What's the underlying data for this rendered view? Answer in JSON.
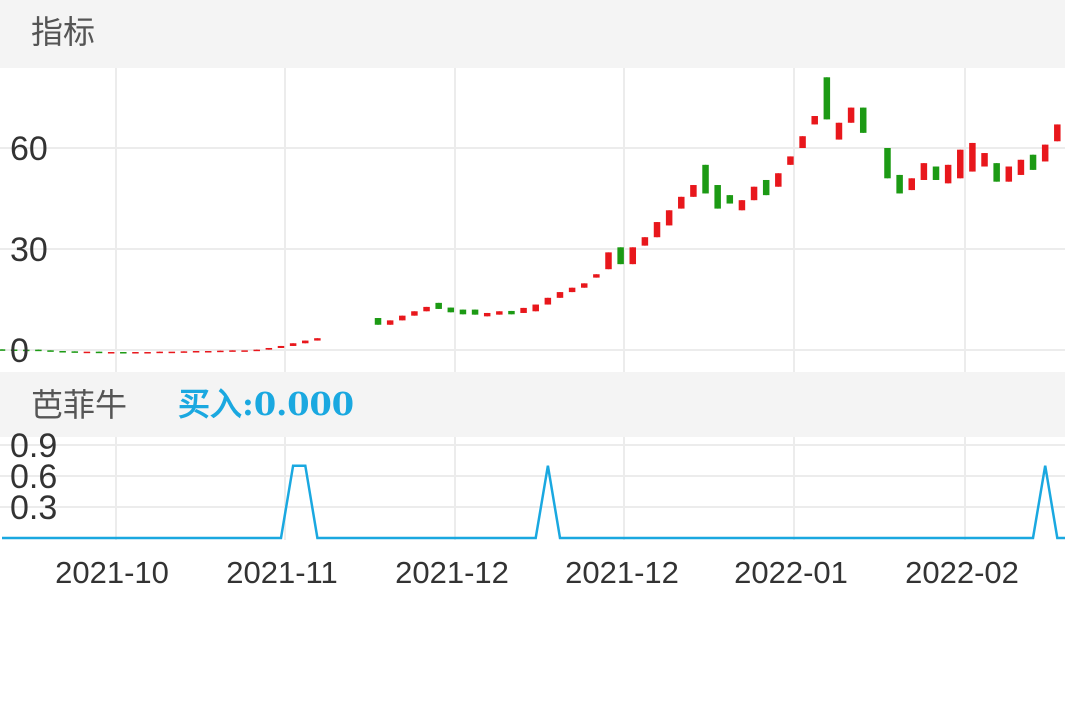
{
  "header": {
    "title": "指标"
  },
  "indicator": {
    "name": "芭菲牛",
    "buy_label": "买入:0.000"
  },
  "colors": {
    "up": "#e8171c",
    "down": "#1c9a14",
    "signal": "#1aa8e0",
    "grid": "#ececec",
    "panel": "#f4f4f4",
    "text": "#333333"
  },
  "chart_data": [
    {
      "type": "candlestick",
      "title": "",
      "y_ticks": [
        "60",
        "30",
        "0"
      ],
      "x_ticks": [
        "2021-10",
        "2021-11",
        "2021-12",
        "2021-12",
        "2022-01",
        "2022-02"
      ],
      "ylim": [
        -10,
        80
      ],
      "grid": true,
      "candles": [
        {
          "o": 0.2,
          "c": 0,
          "h": 0.2,
          "l": 0
        },
        {
          "o": 0.15,
          "c": 0,
          "h": 0.15,
          "l": 0
        },
        {
          "o": 0.1,
          "c": 0,
          "h": 0.1,
          "l": 0
        },
        {
          "o": 0.1,
          "c": -0.1,
          "h": 0.1,
          "l": -0.1
        },
        {
          "o": -0.1,
          "c": -0.3,
          "h": -0.1,
          "l": -0.3
        },
        {
          "o": -0.3,
          "c": -0.4,
          "h": -0.3,
          "l": -0.4
        },
        {
          "o": -0.4,
          "c": -0.5,
          "h": -0.4,
          "l": -0.5
        },
        {
          "o": -0.5,
          "c": -0.5,
          "h": -0.5,
          "l": -0.5
        },
        {
          "o": -0.5,
          "c": -0.6,
          "h": -0.5,
          "l": -0.6
        },
        {
          "o": -0.6,
          "c": -0.6,
          "h": -0.6,
          "l": -0.6
        },
        {
          "o": -0.6,
          "c": -0.7,
          "h": -0.6,
          "l": -0.7
        },
        {
          "o": -0.7,
          "c": -0.6,
          "h": -0.6,
          "l": -0.7
        },
        {
          "o": -0.6,
          "c": -0.6,
          "h": -0.6,
          "l": -0.6
        },
        {
          "o": -0.6,
          "c": -0.5,
          "h": -0.5,
          "l": -0.6
        },
        {
          "o": -0.5,
          "c": -0.5,
          "h": -0.5,
          "l": -0.5
        },
        {
          "o": -0.5,
          "c": -0.4,
          "h": -0.4,
          "l": -0.5
        },
        {
          "o": -0.4,
          "c": -0.3,
          "h": -0.3,
          "l": -0.4
        },
        {
          "o": -0.3,
          "c": -0.3,
          "h": -0.3,
          "l": -0.3
        },
        {
          "o": -0.3,
          "c": -0.2,
          "h": -0.2,
          "l": -0.3
        },
        {
          "o": -0.2,
          "c": -0.1,
          "h": -0.1,
          "l": -0.2
        },
        {
          "o": -0.1,
          "c": -0.1,
          "h": -0.1,
          "l": -0.1
        },
        {
          "o": -0.1,
          "c": 0.1,
          "h": 0.1,
          "l": -0.1
        },
        {
          "o": 0.1,
          "c": 0.6,
          "h": 0.6,
          "l": 0.1
        },
        {
          "o": 0.6,
          "c": 1.2,
          "h": 1.2,
          "l": 0.6
        },
        {
          "o": 1.2,
          "c": 2.0,
          "h": 2.0,
          "l": 1.2
        },
        {
          "o": 2.0,
          "c": 2.8,
          "h": 2.8,
          "l": 2.0
        },
        {
          "o": 2.8,
          "c": 3.5,
          "h": 3.5,
          "l": 2.8
        },
        null,
        null,
        null,
        null,
        {
          "o": 9.5,
          "c": 7.5,
          "h": 9.5,
          "l": 7.5
        },
        {
          "o": 7.5,
          "c": 8.8,
          "h": 8.8,
          "l": 7.5
        },
        {
          "o": 8.8,
          "c": 10.2,
          "h": 10.2,
          "l": 8.8
        },
        {
          "o": 10.2,
          "c": 11.5,
          "h": 11.5,
          "l": 10.2
        },
        {
          "o": 11.5,
          "c": 12.8,
          "h": 12.8,
          "l": 11.5
        },
        {
          "o": 14.0,
          "c": 12.2,
          "h": 14.0,
          "l": 12.2
        },
        {
          "o": 12.6,
          "c": 11.2,
          "h": 12.6,
          "l": 11.2
        },
        {
          "o": 12.0,
          "c": 10.6,
          "h": 12.0,
          "l": 10.6
        },
        {
          "o": 12.0,
          "c": 10.5,
          "h": 12.0,
          "l": 10.5
        },
        {
          "o": 10.0,
          "c": 11.0,
          "h": 11.0,
          "l": 10.0
        },
        {
          "o": 10.5,
          "c": 11.5,
          "h": 11.5,
          "l": 10.5
        },
        {
          "o": 11.6,
          "c": 10.6,
          "h": 11.6,
          "l": 10.6
        },
        {
          "o": 11.0,
          "c": 12.5,
          "h": 12.5,
          "l": 11.0
        },
        {
          "o": 11.5,
          "c": 13.5,
          "h": 13.5,
          "l": 11.5
        },
        {
          "o": 13.5,
          "c": 15.5,
          "h": 15.5,
          "l": 13.5
        },
        {
          "o": 15.5,
          "c": 17.2,
          "h": 17.2,
          "l": 15.5
        },
        {
          "o": 17.2,
          "c": 18.5,
          "h": 18.5,
          "l": 17.2
        },
        {
          "o": 18.5,
          "c": 19.8,
          "h": 19.8,
          "l": 18.5
        },
        {
          "o": 21.5,
          "c": 22.5,
          "h": 22.5,
          "l": 21.5
        },
        {
          "o": 24.0,
          "c": 29.0,
          "h": 29.0,
          "l": 24.0
        },
        {
          "o": 30.5,
          "c": 25.5,
          "h": 30.5,
          "l": 25.5
        },
        {
          "o": 25.5,
          "c": 30.5,
          "h": 30.5,
          "l": 25.5
        },
        {
          "o": 31.0,
          "c": 33.5,
          "h": 33.5,
          "l": 31.0
        },
        {
          "o": 33.5,
          "c": 38.0,
          "h": 38.0,
          "l": 33.5
        },
        {
          "o": 37.0,
          "c": 41.5,
          "h": 41.5,
          "l": 37.0
        },
        {
          "o": 42.0,
          "c": 45.5,
          "h": 45.5,
          "l": 42.0
        },
        {
          "o": 45.5,
          "c": 49.0,
          "h": 49.0,
          "l": 45.5
        },
        {
          "o": 55.0,
          "c": 46.5,
          "h": 55.0,
          "l": 46.5
        },
        {
          "o": 49.0,
          "c": 42.0,
          "h": 49.0,
          "l": 42.0
        },
        {
          "o": 46.0,
          "c": 43.5,
          "h": 46.0,
          "l": 43.5
        },
        {
          "o": 41.5,
          "c": 44.5,
          "h": 44.5,
          "l": 41.5
        },
        {
          "o": 44.5,
          "c": 48.5,
          "h": 48.5,
          "l": 44.5
        },
        {
          "o": 50.5,
          "c": 46.0,
          "h": 50.5,
          "l": 46.0
        },
        {
          "o": 48.5,
          "c": 52.5,
          "h": 52.5,
          "l": 48.5
        },
        {
          "o": 55.0,
          "c": 57.5,
          "h": 57.5,
          "l": 55.0
        },
        {
          "o": 60.0,
          "c": 63.5,
          "h": 63.5,
          "l": 60.0
        },
        {
          "o": 67.0,
          "c": 69.5,
          "h": 69.5,
          "l": 67.0
        },
        {
          "o": 81.0,
          "c": 68.5,
          "h": 81.0,
          "l": 68.5
        },
        {
          "o": 62.5,
          "c": 67.5,
          "h": 67.5,
          "l": 62.5
        },
        {
          "o": 67.5,
          "c": 72.0,
          "h": 72.0,
          "l": 67.5
        },
        {
          "o": 72.0,
          "c": 64.5,
          "h": 72.0,
          "l": 64.5
        },
        null,
        {
          "o": 60.0,
          "c": 51.0,
          "h": 60.0,
          "l": 51.0
        },
        {
          "o": 52.0,
          "c": 46.5,
          "h": 52.0,
          "l": 46.5
        },
        {
          "o": 47.5,
          "c": 51.0,
          "h": 51.0,
          "l": 47.5
        },
        {
          "o": 50.5,
          "c": 55.5,
          "h": 55.5,
          "l": 50.5
        },
        {
          "o": 54.5,
          "c": 50.5,
          "h": 54.5,
          "l": 50.5
        },
        {
          "o": 49.5,
          "c": 55.0,
          "h": 55.0,
          "l": 49.5
        },
        {
          "o": 51.0,
          "c": 59.5,
          "h": 59.5,
          "l": 51.0
        },
        {
          "o": 53.0,
          "c": 61.5,
          "h": 61.5,
          "l": 53.0
        },
        {
          "o": 54.5,
          "c": 58.5,
          "h": 58.5,
          "l": 54.5
        },
        {
          "o": 55.5,
          "c": 50.0,
          "h": 55.5,
          "l": 50.0
        },
        {
          "o": 50.0,
          "c": 54.5,
          "h": 54.5,
          "l": 50.0
        },
        {
          "o": 52.0,
          "c": 56.5,
          "h": 56.5,
          "l": 52.0
        },
        {
          "o": 58.0,
          "c": 53.5,
          "h": 58.0,
          "l": 53.5
        },
        {
          "o": 56.0,
          "c": 61.0,
          "h": 61.0,
          "l": 56.0
        },
        {
          "o": 62.0,
          "c": 67.0,
          "h": 67.0,
          "l": 62.0
        },
        {
          "o": 66.0,
          "c": 61.5,
          "h": 66.0,
          "l": 61.5
        },
        {
          "o": 67.0,
          "c": 61.5,
          "h": 67.0,
          "l": 61.5
        },
        {
          "o": 63.5,
          "c": 58.5,
          "h": 63.5,
          "l": 58.5
        },
        {
          "o": 58.5,
          "c": 62.0,
          "h": 62.0,
          "l": 58.5
        }
      ]
    },
    {
      "type": "line",
      "title": "",
      "series_name": "买入",
      "y_ticks": [
        "0.9",
        "0.6",
        "0.3"
      ],
      "ylim": [
        0,
        1.0
      ],
      "grid": true,
      "values": [
        0,
        0,
        0,
        0,
        0,
        0,
        0,
        0,
        0,
        0,
        0,
        0,
        0,
        0,
        0,
        0,
        0,
        0,
        0,
        0,
        0,
        0,
        0,
        0,
        0.7,
        0.7,
        0,
        0,
        0,
        0,
        0,
        0,
        0,
        0,
        0,
        0,
        0,
        0,
        0,
        0,
        0,
        0,
        0,
        0,
        0,
        0.7,
        0,
        0,
        0,
        0,
        0,
        0,
        0,
        0,
        0,
        0,
        0,
        0,
        0,
        0,
        0,
        0,
        0,
        0,
        0,
        0,
        0,
        0,
        0,
        0,
        0,
        0,
        0,
        0,
        0,
        0,
        0,
        0,
        0,
        0,
        0,
        0,
        0,
        0,
        0,
        0,
        0.7,
        0,
        0,
        0,
        0
      ]
    }
  ]
}
